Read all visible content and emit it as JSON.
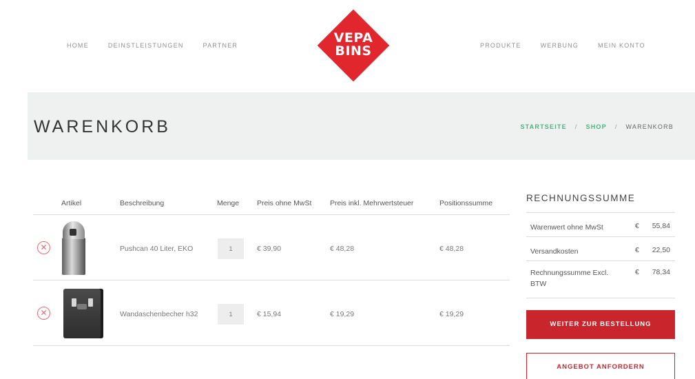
{
  "nav": {
    "left": [
      "HOME",
      "DEINSTLEISTUNGEN",
      "PARTNER"
    ],
    "right": [
      "PRODUKTE",
      "WERBUNG",
      "MEIN KONTO"
    ]
  },
  "logo": {
    "line1": "VEPA",
    "line2": "BINS",
    "color": "#e1262e"
  },
  "page": {
    "title": "WARENKORB",
    "breadcrumb": {
      "home": "STARTSEITE",
      "shop": "SHOP",
      "current": "WARENKORB",
      "separator": "/"
    }
  },
  "cart": {
    "headers": {
      "article": "Artikel",
      "description": "Beschreibung",
      "quantity": "Menge",
      "price_net": "Preis ohne MwSt",
      "price_gross": "Preis inkl. Mehrwertsteuer",
      "line_total": "Positionssumme"
    },
    "items": [
      {
        "image_icon": "pushcan-bin-image",
        "description": "Pushcan 40 Liter, EKO",
        "quantity": "1",
        "price_net": "€ 39,90",
        "price_gross": "€ 48,28",
        "line_total": "€ 48,28"
      },
      {
        "image_icon": "wall-ashtray-image",
        "description": "Wandaschenbecher h32",
        "quantity": "1",
        "price_net": "€ 15,94",
        "price_gross": "€ 19,29",
        "line_total": "€ 19,29"
      }
    ]
  },
  "summary": {
    "title": "RECHNUNGSSUMME",
    "rows": [
      {
        "label": "Warenwert ohne MwSt",
        "currency": "€",
        "amount": "55,84"
      },
      {
        "label": "Versandkosten",
        "currency": "€",
        "amount": "22,50"
      },
      {
        "label": "Rechnungssumme Excl. BTW",
        "currency": "€",
        "amount": "78,34"
      }
    ],
    "primary_button": "WEITER ZUR BESTELLUNG",
    "secondary_button": "ANGEBOT ANFORDERN",
    "accent_color": "#c8262c"
  },
  "colors": {
    "breadcrumb_link": "#4cb087",
    "remove_icon": "#e26b70",
    "banner_bg": "#eff1f0"
  }
}
